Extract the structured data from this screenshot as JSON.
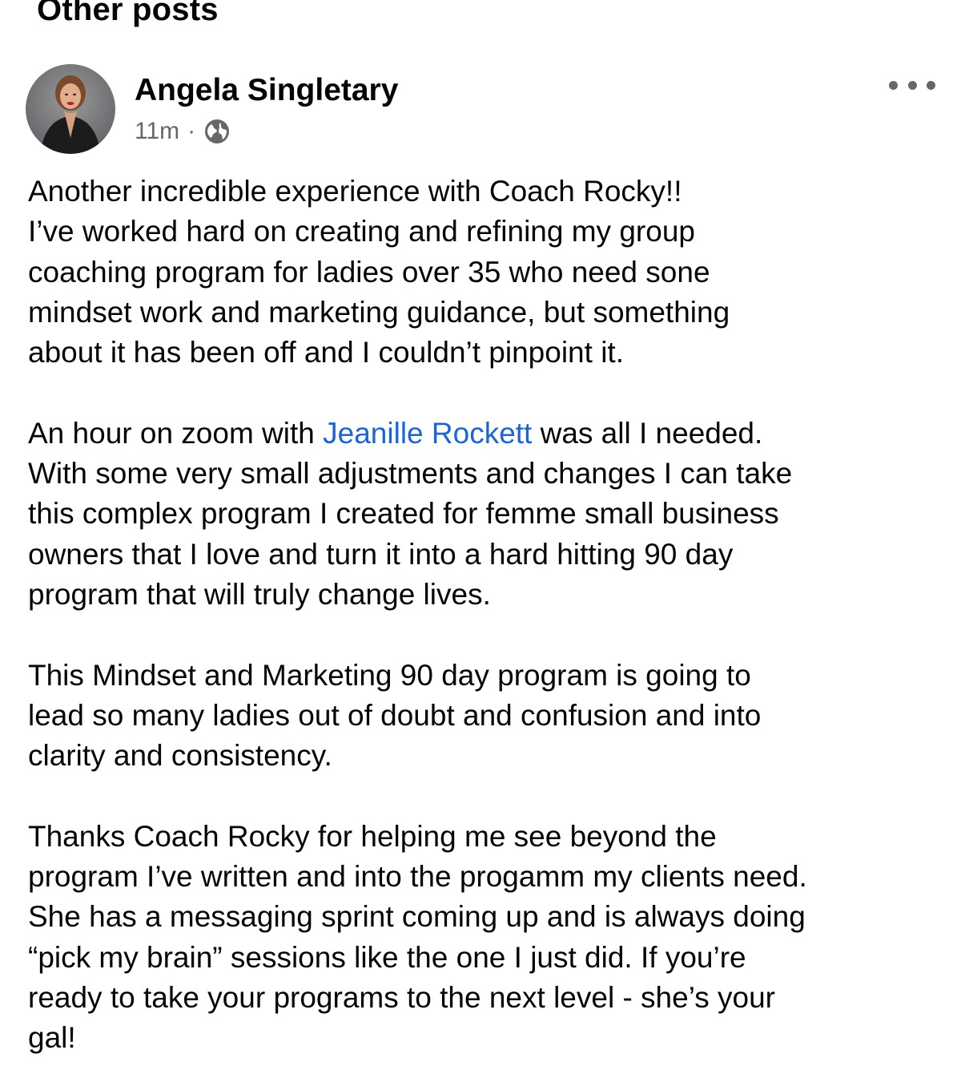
{
  "section": {
    "title": "Other posts"
  },
  "post": {
    "author": {
      "name": "Angela Singletary",
      "avatar_icon": "profile-photo"
    },
    "meta": {
      "time": "11m",
      "separator": "·",
      "privacy_icon": "globe-icon"
    },
    "more_icon": "more-options-icon",
    "paragraphs": [
      {
        "lines": [
          "Another incredible experience with Coach Rocky!!",
          "I’ve worked hard on creating and refining my group",
          "coaching program for ladies over 35 who need sone",
          "mindset work and marketing guidance, but something",
          "about it has been off and I couldn’t pinpoint it."
        ]
      },
      {
        "first_line": {
          "before": "An hour on zoom with ",
          "mention": "Jeanille Rockett",
          "after": " was all I needed."
        },
        "lines": [
          "With some very small adjustments and changes I can take",
          "this complex program I created for femme small business",
          "owners that I love and turn it into a hard hitting 90 day",
          "program that will truly change lives."
        ]
      },
      {
        "lines": [
          "This Mindset and Marketing 90 day program is going to",
          "lead so many ladies out of doubt and confusion and into",
          "clarity and consistency."
        ]
      },
      {
        "lines": [
          "Thanks Coach Rocky for helping me see beyond the",
          "program I’ve written and into the progamm my clients need.",
          "She has a messaging sprint coming up and is always doing",
          "“pick my brain” sessions like the one I just did. If you’re",
          "ready to take your programs to the next level - she’s your",
          "gal!"
        ]
      }
    ]
  },
  "colors": {
    "text": "#050505",
    "secondary_text": "#65676b",
    "mention_link": "#1b65d4",
    "background": "#ffffff"
  }
}
